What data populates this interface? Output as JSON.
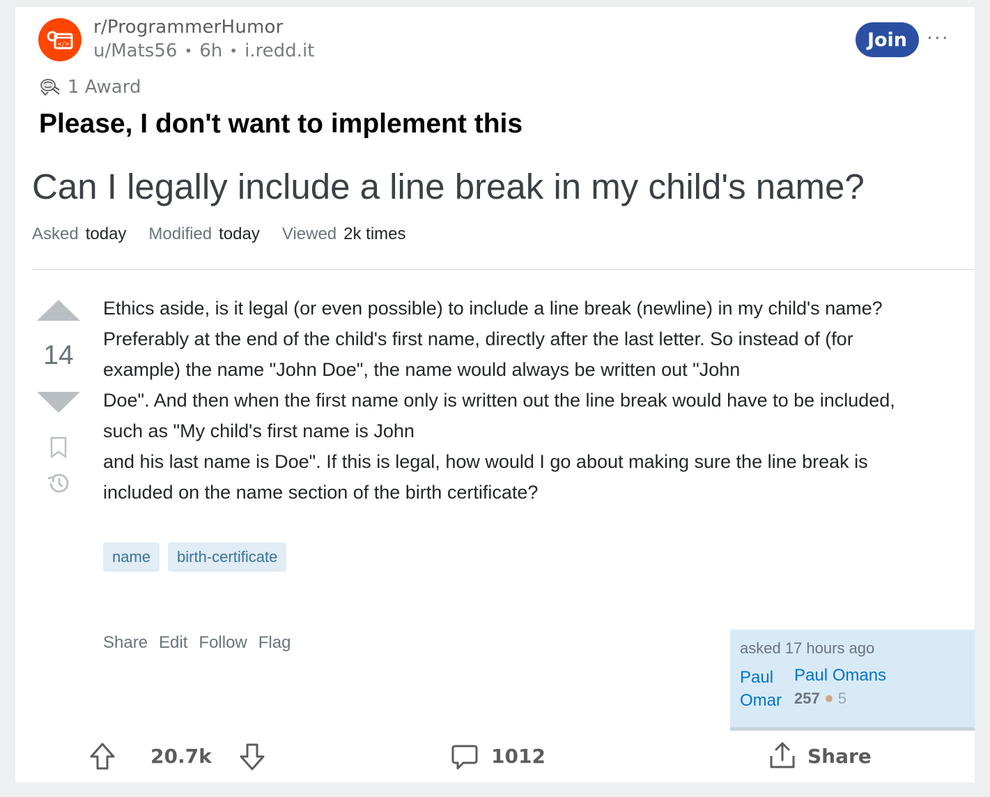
{
  "post": {
    "subreddit": "r/ProgrammerHumor",
    "author": "u/Mats56",
    "age": "6h",
    "domain": "i.redd.it",
    "join_label": "Join",
    "more_label": "···",
    "awards": "1 Award",
    "title": "Please, I don't want to implement this"
  },
  "question": {
    "title": "Can I legally include a line break in my child's name?",
    "meta": [
      {
        "key": "Asked",
        "value": "today"
      },
      {
        "key": "Modified",
        "value": "today"
      },
      {
        "key": "Viewed",
        "value": "2k times"
      }
    ],
    "votes": "14",
    "body": [
      "Ethics aside, is it legal (or even possible) to include a line break (newline) in my child's name?",
      "Preferably at the end of the child's first name, directly after the last letter. So instead of (for",
      "example) the name \"John Doe\", the name would always be written out \"John",
      "Doe\". And then when the first name only is written out the line break would have to be included,",
      "such as \"My child's first name is John",
      "and his last name is Doe\". If this is legal, how would I go about making sure the line break is",
      "included on the name section of the birth certificate?"
    ],
    "tags": [
      "name",
      "birth-certificate"
    ],
    "actions": [
      "Share",
      "Edit",
      "Follow",
      "Flag"
    ],
    "asker": {
      "asked": "asked 17 hours ago",
      "first_name": "Paul Omar",
      "alias": "Paul Omans",
      "reputation": "257",
      "bronze_badges": "5"
    }
  },
  "action_bar": {
    "score": "20.7k",
    "comments": "1012",
    "share_label": "Share"
  },
  "colors": {
    "subreddit_icon": "#ff4500",
    "join_button": "#2b4fa3",
    "tag_bg": "#e1ecf4",
    "tag_text": "#39739d",
    "link": "#0074cc"
  }
}
